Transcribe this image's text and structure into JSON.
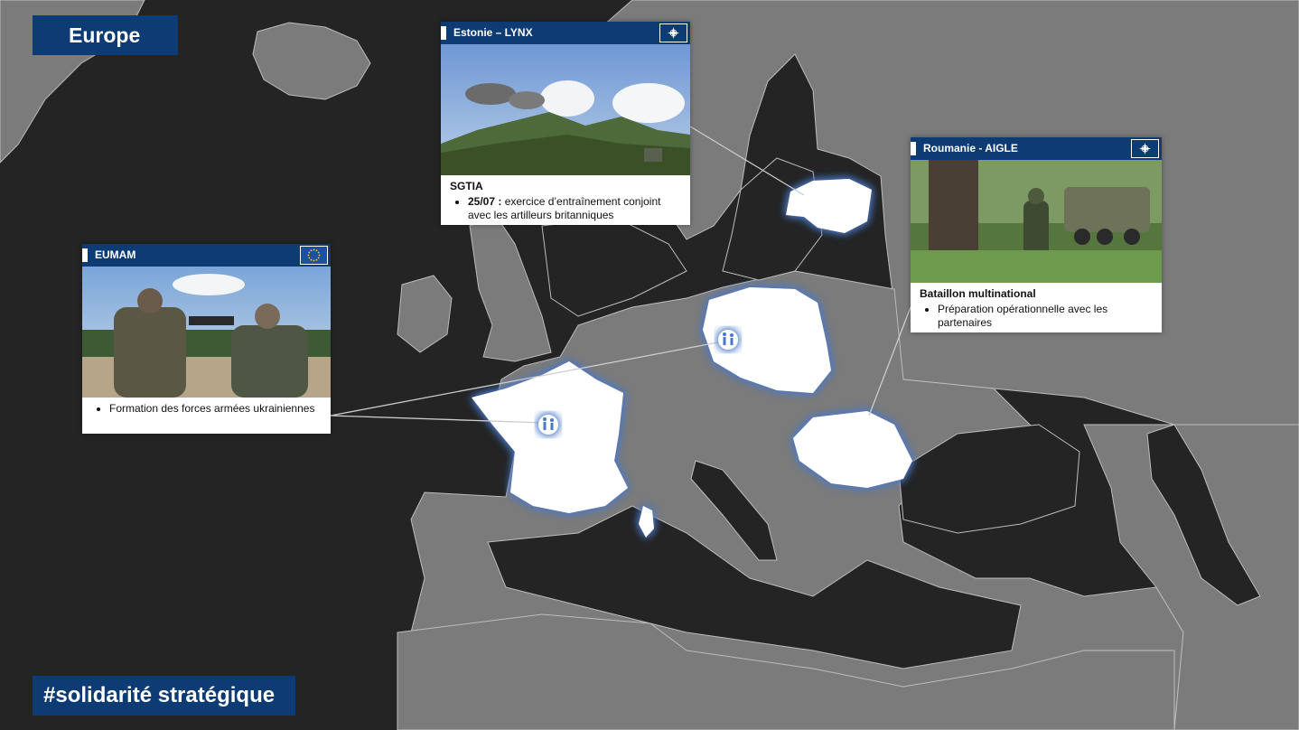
{
  "page": {
    "title": "Europe",
    "hashtag": "#solidarité stratégique"
  },
  "colors": {
    "navy": "#0d3b73",
    "sea": "#242424",
    "land": "#7b7b7b",
    "highlight": "#ffffff",
    "glow": "#4a78c8"
  },
  "cards": {
    "estonia": {
      "title": "Estonie – LYNX",
      "badge_icon": "nato-star-icon",
      "heading": "SGTIA",
      "bullet_date": "25/07 :",
      "bullet_text": "exercice d’entraînement conjoint avec les artilleurs britanniques"
    },
    "romania": {
      "title": "Roumanie - AIGLE",
      "badge_icon": "nato-star-icon",
      "heading": "Bataillon multinational",
      "bullet_text": "Préparation opérationnelle avec les partenaires"
    },
    "eumam": {
      "title": "EUMAM",
      "badge_icon": "eu-flag-icon",
      "bullet_text": "Formation des forces armées ukrainiennes"
    }
  },
  "markers": {
    "icon": "soldiers-icon"
  }
}
